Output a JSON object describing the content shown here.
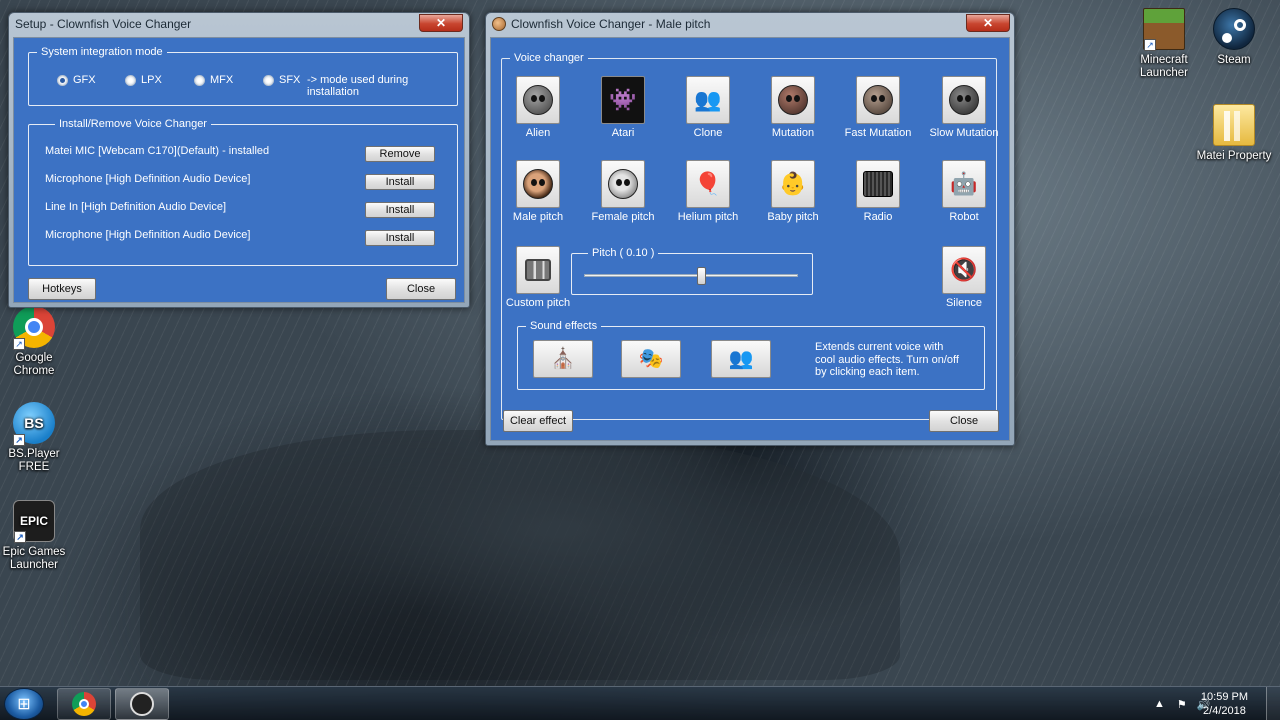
{
  "desktop": {
    "icons_left": [
      {
        "label": "Google Chrome"
      },
      {
        "label": "BS.Player FREE",
        "badge": "BS"
      },
      {
        "label": "Epic Games Launcher",
        "badge": "EPIC"
      }
    ],
    "icons_right": [
      {
        "label": "Minecraft Launcher"
      },
      {
        "label": "Steam"
      },
      {
        "label": "Matei Property"
      }
    ]
  },
  "setup_window": {
    "title": "Setup - Clownfish Voice Changer",
    "close_glyph": "✕",
    "integration": {
      "title": "System integration mode",
      "options": [
        "GFX",
        "LPX",
        "MFX",
        "SFX"
      ],
      "selected": "GFX",
      "note": "-> mode used during installation"
    },
    "install": {
      "title": "Install/Remove Voice Changer",
      "rows": [
        {
          "device": "Matei MIC [Webcam C170](Default) - installed",
          "action": "Remove"
        },
        {
          "device": "Microphone [High Definition Audio Device]",
          "action": "Install"
        },
        {
          "device": "Line In [High Definition Audio Device]",
          "action": "Install"
        },
        {
          "device": "Microphone [High Definition Audio Device]",
          "action": "Install"
        }
      ]
    },
    "hotkeys_label": "Hotkeys",
    "close_label": "Close"
  },
  "voice_window": {
    "title": "Clownfish Voice Changer - Male pitch",
    "close_glyph": "✕",
    "group_title": "Voice changer",
    "voices_row1": [
      "Alien",
      "Atari",
      "Clone",
      "Mutation",
      "Fast Mutation",
      "Slow Mutation"
    ],
    "voices_row2": [
      "Male pitch",
      "Female pitch",
      "Helium pitch",
      "Baby pitch",
      "Radio",
      "Robot"
    ],
    "custom_pitch_label": "Custom pitch",
    "silence_label": "Silence",
    "pitch_label": "Pitch ( 0.10 )",
    "pitch_value": 0.1,
    "sound_effects_title": "Sound effects",
    "sound_effects_desc": "Extends current voice with cool audio effects. Turn on/off by clicking each item.",
    "clear_effect_label": "Clear effect",
    "close_label": "Close"
  },
  "taskbar": {
    "time": "10:59 PM",
    "date": "2/4/2018"
  }
}
